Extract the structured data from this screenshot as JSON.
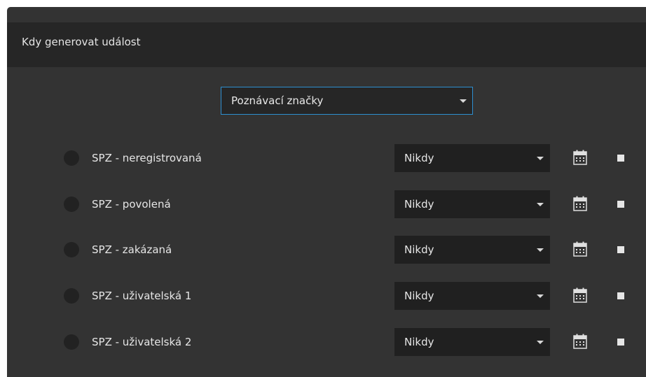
{
  "panel": {
    "title": "Kdy generovat událost"
  },
  "type_select": {
    "value": "Poznávací značky"
  },
  "rows": [
    {
      "label": "SPZ - neregistrovaná",
      "schedule": "Nikdy"
    },
    {
      "label": "SPZ - povolená",
      "schedule": "Nikdy"
    },
    {
      "label": "SPZ - zakázaná",
      "schedule": "Nikdy"
    },
    {
      "label": "SPZ - uživatelská 1",
      "schedule": "Nikdy"
    },
    {
      "label": "SPZ - uživatelská 2",
      "schedule": "Nikdy"
    }
  ],
  "icons": {
    "calendar": "calendar-icon",
    "dropdown": "chevron-down-icon",
    "square": "stop-square-icon"
  },
  "colors": {
    "panel_bg": "#333333",
    "header_bg": "#262626",
    "select_border": "#2d8fd0",
    "row_select_bg": "#202020"
  }
}
